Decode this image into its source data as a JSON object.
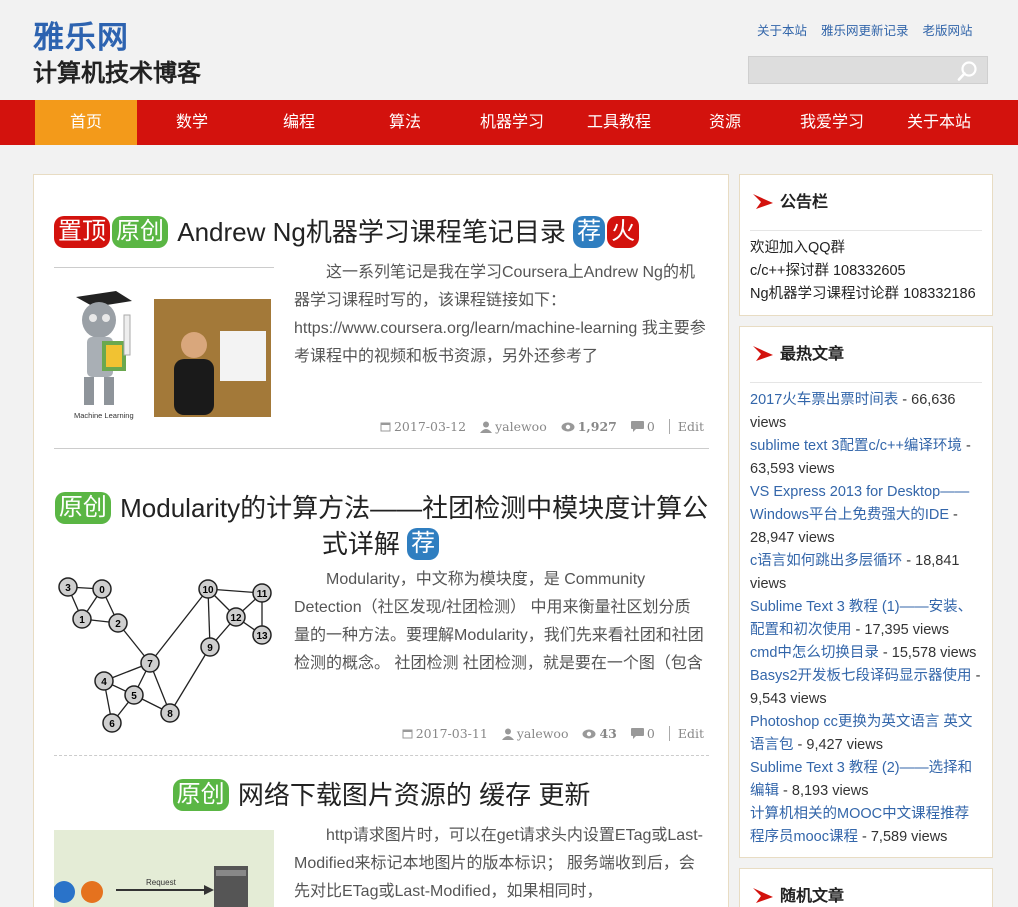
{
  "header": {
    "site_name": "雅乐网",
    "site_desc": "计算机技术博客",
    "top_links": [
      "关于本站",
      "雅乐网更新记录",
      "老版网站"
    ],
    "search_placeholder": ""
  },
  "nav": {
    "items": [
      "首页",
      "数学",
      "编程",
      "算法",
      "机器学习",
      "工具教程",
      "资源",
      "我爱学习",
      "关于本站"
    ],
    "active": "首页"
  },
  "posts": [
    {
      "badges": [
        "置顶",
        "原创"
      ],
      "title": "Andrew Ng机器学习课程笔记目录",
      "tail_badges": [
        "荐",
        "火"
      ],
      "excerpt": "这一系列笔记是我在学习Coursera上Andrew Ng的机器学习课程时写的，该课程链接如下：https://www.coursera.org/learn/machine-learning 我主要参考课程中的视频和板书资源，另外还参考了",
      "thumb_caption": "Machine Learning",
      "date": "2017-03-12",
      "author": "yalewoo",
      "views": "1,927",
      "comments": "0",
      "edit": "Edit"
    },
    {
      "badges": [
        "原创"
      ],
      "title": "Modularity的计算方法——社团检测中模块度计算公式详解",
      "tail_badges": [
        "荐"
      ],
      "excerpt": "Modularity，中文称为模块度，是 Community Detection（社区发现/社团检测） 中用来衡量社区划分质量的一种方法。要理解Modularity，我们先来看社团和社团检测的概念。 社团检测 社团检测，就是要在一个图（包含",
      "graph_nodes": [
        "0",
        "1",
        "2",
        "3",
        "4",
        "5",
        "6",
        "7",
        "8",
        "9",
        "10",
        "11",
        "12",
        "13"
      ],
      "date": "2017-03-11",
      "author": "yalewoo",
      "views": "43",
      "comments": "0",
      "edit": "Edit"
    },
    {
      "badges": [
        "原创"
      ],
      "title": "网络下载图片资源的 缓存 更新",
      "tail_badges": [],
      "excerpt": "http请求图片时，可以在get请求头内设置ETag或Last-Modified来标记本地图片的版本标识； 服务端收到后，会先对比ETag或Last-Modified，如果相同时，",
      "thumb_caption": "Request"
    }
  ],
  "sidebar": {
    "notice": {
      "title": "公告栏",
      "lines": [
        "欢迎加入QQ群",
        "c/c++探讨群 108332605",
        "Ng机器学习课程讨论群 108332186"
      ]
    },
    "hot": {
      "title": "最热文章",
      "items": [
        {
          "title": "2017火车票出票时间表",
          "count": " - 66,636 views"
        },
        {
          "title": "sublime text 3配置c/c++编译环境",
          "count": " - 63,593 views"
        },
        {
          "title": "VS Express 2013 for Desktop——Windows平台上免费强大的IDE",
          "count": " - 28,947 views"
        },
        {
          "title": "c语言如何跳出多层循环",
          "count": " - 18,841 views"
        },
        {
          "title": "Sublime Text 3 教程 (1)——安装、配置和初次使用",
          "count": " - 17,395 views"
        },
        {
          "title": "cmd中怎么切换目录",
          "count": " - 15,578 views"
        },
        {
          "title": "Basys2开发板七段译码显示器使用",
          "count": " - 9,543 views"
        },
        {
          "title": "Photoshop cc更换为英文语言 英文语言包",
          "count": " - 9,427 views"
        },
        {
          "title": "Sublime Text 3 教程 (2)——选择和编辑",
          "count": " - 8,193 views"
        },
        {
          "title": "计算机相关的MOOC中文课程推荐 程序员mooc课程",
          "count": " - 7,589 views"
        }
      ]
    },
    "random": {
      "title": "随机文章"
    }
  },
  "colors": {
    "nav_bg": "#d3120d",
    "nav_active": "#f39a1a",
    "brand": "#2d63b0",
    "badge_red": "#d3120d",
    "badge_green": "#5ab644",
    "badge_blue": "#2f7ec0",
    "link": "#3366aa"
  }
}
